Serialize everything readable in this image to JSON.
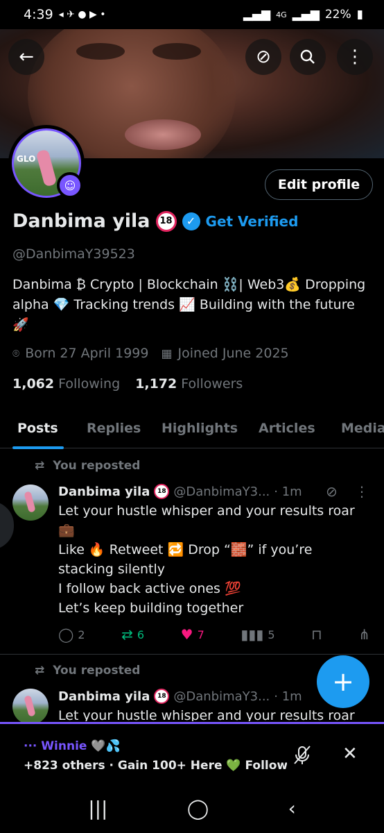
{
  "status_bar": {
    "time": "4:39",
    "left_icons": "◂ ✈ ● ▶ •",
    "network": "4G",
    "battery": "22%"
  },
  "banner": {
    "back": "←",
    "grok": "⊘",
    "search": "⚲",
    "more": "⋮"
  },
  "profile": {
    "edit_label": "Edit profile",
    "name": "Danbima yila",
    "badge_18": "18",
    "get_verified": "Get Verified",
    "handle": "@DanbimaY39523",
    "bio": "Danbima ₿ Crypto | Blockchain ⛓️| Web3💰 Dropping alpha 💎 Tracking trends 📈 Building with the future 🚀",
    "born": "Born 27 April 1999",
    "joined": "Joined June 2025",
    "following_count": "1,062",
    "following_label": "Following",
    "followers_count": "1,172",
    "followers_label": "Followers"
  },
  "tabs": [
    {
      "label": "Posts"
    },
    {
      "label": "Replies"
    },
    {
      "label": "Highlights"
    },
    {
      "label": "Articles"
    },
    {
      "label": "Media"
    }
  ],
  "posts": [
    {
      "repost_label": "You reposted",
      "name": "Danbima yila",
      "handle": "@DanbimaY3...",
      "time": "· 1m",
      "line1": "Let your hustle whisper and your results roar",
      "line2": "💼",
      "line3": "Like 🔥 Retweet 🔁 Drop “🧱” if you’re",
      "line4": "stacking silently",
      "line5": "I follow back active ones 💯",
      "line6": "Let’s keep building together",
      "replies": "2",
      "reposts": "6",
      "likes": "7",
      "views": "5"
    },
    {
      "repost_label": "You reposted",
      "name": "Danbima yila",
      "handle": "@DanbimaY3...",
      "time": "· 1m",
      "line1": "Let your hustle whisper and your results roar"
    }
  ],
  "fab": "+",
  "spaces": {
    "title": "··· Winnie 🩶💦",
    "subtitle": "+823 others · Gain 100+ Here 💚 Follow ...",
    "close": "✕"
  },
  "navbar": {
    "recents": "|||",
    "home": "◯",
    "back": "‹"
  }
}
